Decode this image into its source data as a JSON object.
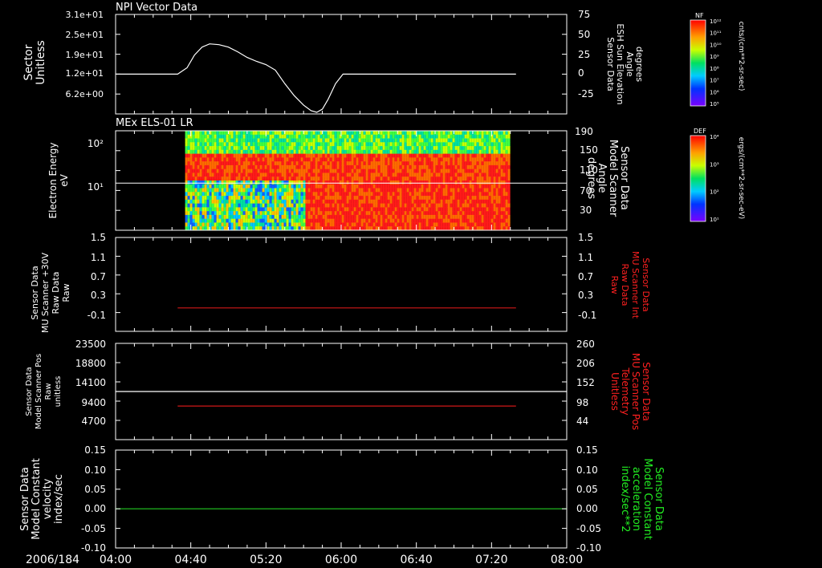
{
  "date_label": "2006/184",
  "time_ticks": [
    "04:00",
    "04:40",
    "05:20",
    "06:00",
    "06:40",
    "07:20",
    "08:00"
  ],
  "colors": {
    "background": "#000000",
    "axis": "#ffffff",
    "red_label": "#ff2020",
    "green_label": "#22ee22",
    "red_line": "#d01818",
    "green_line": "#22cc22"
  },
  "chart_data": [
    {
      "id": "panel1",
      "type": "line",
      "title": "NPI Vector Data",
      "ylabel_left": [
        "Sector",
        "Unitless"
      ],
      "left_ticks": [
        "3.1e+01",
        "2.5e+01",
        "1.9e+01",
        "1.2e+01",
        "6.2e+00"
      ],
      "ylabel_right": [
        "Sensor Data",
        "ESH Sun Elevation",
        "Angle",
        "degrees"
      ],
      "right_ticks": [
        "75",
        "50",
        "25",
        "0",
        "-25"
      ],
      "right_ylim": [
        -50,
        75
      ],
      "series": [
        {
          "color": "#ffffff",
          "x": [
            "04:00",
            "04:33",
            "04:38",
            "04:42",
            "04:46",
            "04:50",
            "04:55",
            "05:00",
            "05:05",
            "05:10",
            "05:15",
            "05:20",
            "05:25",
            "05:30",
            "05:35",
            "05:40",
            "05:44",
            "05:47",
            "05:50",
            "05:53",
            "05:57",
            "06:01",
            "07:33"
          ],
          "y": [
            0,
            0,
            8,
            24,
            34,
            38,
            37,
            34,
            28,
            21,
            16,
            12,
            5,
            -12,
            -27,
            -39,
            -46,
            -48,
            -44,
            -32,
            -12,
            0,
            0
          ]
        }
      ],
      "colorbar": {
        "label": "NF",
        "units": "cnts/(cm**2-sr-sec)",
        "tick_labels": [
          "10¹²",
          "10¹¹",
          "10¹⁰",
          "10⁹",
          "10⁸",
          "10⁷",
          "10⁶",
          "10⁵"
        ]
      }
    },
    {
      "id": "panel2",
      "type": "heatmap",
      "title": "MEx ELS-01 LR",
      "ylabel_left": [
        "Electron Energy",
        "eV"
      ],
      "left_ticks": [
        "10²",
        "10¹"
      ],
      "ylabel_right": [
        "Sensor Data",
        "Model Scanner",
        "Angle",
        "degrees"
      ],
      "right_ticks": [
        "190",
        "150",
        "110",
        "70",
        "30"
      ],
      "right_ylim": [
        0,
        190
      ],
      "x_range": [
        "04:37",
        "07:29"
      ],
      "scanner_angle_line": 90,
      "colorbar": {
        "label": "DEF",
        "units": "ergs/(cm**2-sr-sec-eV)",
        "tick_labels": [
          "10⁴",
          "10³",
          "10²",
          "10¹"
        ]
      }
    },
    {
      "id": "panel3",
      "type": "line",
      "ylabel_left": [
        "Sensor Data",
        "MU Scanner +30V",
        "Raw Data",
        "Raw"
      ],
      "left_ticks": [
        "1.5",
        "1.1",
        "0.7",
        "0.3",
        "-0.1"
      ],
      "ylabel_right": [
        "Sensor Data",
        "MU Scanner Int",
        "Raw Data",
        "Raw"
      ],
      "right_ticks": [
        "1.5",
        "1.1",
        "0.7",
        "0.3",
        "-0.1"
      ],
      "ylim": [
        -0.5,
        1.5
      ],
      "series": [
        {
          "color": "#d01818",
          "x": [
            "04:33",
            "07:33"
          ],
          "y": [
            0.0,
            0.0
          ]
        }
      ]
    },
    {
      "id": "panel4",
      "type": "line",
      "ylabel_left": [
        "Sensor Data",
        "Model Scanner Pos",
        "Raw",
        "unitless"
      ],
      "left_ticks": [
        "23500",
        "18800",
        "14100",
        "9400",
        "4700"
      ],
      "ylabel_right": [
        "Sensor Data",
        "MU Scanner Pos",
        "Telemetry",
        "Unitless"
      ],
      "right_ticks": [
        "260",
        "206",
        "152",
        "98",
        "44"
      ],
      "ylim": [
        0,
        23500
      ],
      "series": [
        {
          "color": "#ffffff",
          "x": [
            "04:00",
            "08:00"
          ],
          "y": [
            11750,
            11750
          ]
        },
        {
          "color": "#d01818",
          "x": [
            "04:33",
            "07:33"
          ],
          "y": [
            8200,
            8200
          ]
        }
      ]
    },
    {
      "id": "panel5",
      "type": "line",
      "ylabel_left": [
        "Sensor Data",
        "Model Constant",
        "velocity",
        "index/sec"
      ],
      "left_ticks": [
        "0.15",
        "0.10",
        "0.05",
        "0.00",
        "-0.05",
        "-0.10"
      ],
      "ylabel_right": [
        "Sensor Data",
        "Model Constant",
        "acceleration",
        "index/sec**2"
      ],
      "right_ticks": [
        "0.15",
        "0.10",
        "0.05",
        "0.00",
        "-0.05",
        "-0.10"
      ],
      "ylim": [
        -0.1,
        0.15
      ],
      "series": [
        {
          "color": "#22cc22",
          "x": [
            "04:00",
            "08:00"
          ],
          "y": [
            0.0,
            0.0
          ]
        }
      ]
    }
  ]
}
